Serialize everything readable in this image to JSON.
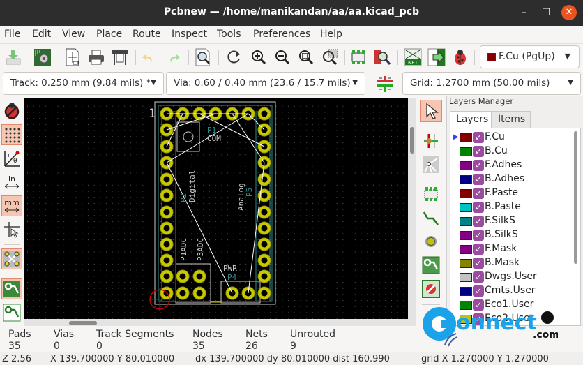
{
  "window": {
    "title": "Pcbnew — /home/manikandan/aa/aa.kicad_pcb",
    "minimize_label": "–",
    "maximize_label": "☐",
    "close_label": "✕"
  },
  "menu": [
    "File",
    "Edit",
    "View",
    "Place",
    "Route",
    "Inspect",
    "Tools",
    "Preferences",
    "Help"
  ],
  "toolbar": {
    "icons": [
      "save-icon",
      "board-setup-icon",
      "page-settings-icon",
      "print-icon",
      "plot-icon",
      "undo-icon",
      "redo-icon",
      "find-icon",
      "redraw-icon",
      "zoom-in-icon",
      "zoom-out-icon",
      "zoom-fit-icon",
      "zoom-selection-icon",
      "footprint-editor-icon",
      "footprint-viewer-icon",
      "netlist-icon",
      "update-from-schematic-icon",
      "drc-icon"
    ],
    "active_layer": {
      "label": "F.Cu (PgUp)",
      "color": "#840000"
    }
  },
  "toolbar2": {
    "track": "Track: 0.250 mm (9.84 mils) *",
    "via": "Via: 0.60 / 0.40 mm (23.6 / 15.7 mils) *",
    "grid": "Grid: 1.2700 mm (50.00 mils)"
  },
  "left_toolbar": {
    "items": [
      {
        "name": "drc-off-icon",
        "active": false
      },
      {
        "name": "grid-toggle-icon",
        "active": true
      },
      {
        "name": "polar-coords-icon",
        "active": false
      },
      {
        "name": "units-inches-icon",
        "label": "in",
        "active": false
      },
      {
        "name": "units-mm-icon",
        "label": "mm",
        "active": true
      },
      {
        "name": "cursor-shape-icon",
        "active": false
      },
      {
        "name": "ratsnest-icon",
        "active": true
      },
      {
        "name": "zone-fill-icon",
        "active": true
      },
      {
        "name": "zone-outline-icon",
        "active": false
      }
    ]
  },
  "right_toolbar": {
    "items": [
      "select-icon",
      "local-ratsnest-icon",
      "highlight-net-icon",
      "add-footprint-icon",
      "route-track-icon",
      "add-via-icon",
      "add-zone-icon",
      "add-keepout-icon"
    ]
  },
  "canvas": {
    "pin1_label": "1",
    "labels": {
      "p1": "P1",
      "com": "COM",
      "p2": "P2",
      "digital": "Digital",
      "analog": "Analog",
      "p5": "P5",
      "p1adc": "P1ADC",
      "p3adc": "P3ADC",
      "pwr": "PWR",
      "p4": "P4"
    }
  },
  "layers_manager": {
    "title": "Layers Manager",
    "tabs": [
      "Layers",
      "Items"
    ],
    "active_tab": "Layers",
    "layers": [
      {
        "name": "F.Cu",
        "color": "#840000",
        "visible": true,
        "selected": true
      },
      {
        "name": "B.Cu",
        "color": "#008400",
        "visible": true
      },
      {
        "name": "F.Adhes",
        "color": "#840084",
        "visible": true
      },
      {
        "name": "B.Adhes",
        "color": "#000084",
        "visible": true
      },
      {
        "name": "F.Paste",
        "color": "#840000",
        "visible": true
      },
      {
        "name": "B.Paste",
        "color": "#00c2c2",
        "visible": true
      },
      {
        "name": "F.SilkS",
        "color": "#008484",
        "visible": true
      },
      {
        "name": "B.SilkS",
        "color": "#840084",
        "visible": true
      },
      {
        "name": "F.Mask",
        "color": "#840084",
        "visible": true
      },
      {
        "name": "B.Mask",
        "color": "#848400",
        "visible": true
      },
      {
        "name": "Dwgs.User",
        "color": "#c2c2c2",
        "visible": true
      },
      {
        "name": "Cmts.User",
        "color": "#000084",
        "visible": true
      },
      {
        "name": "Eco1.User",
        "color": "#008400",
        "visible": true
      },
      {
        "name": "Eco2.User",
        "color": "#c2c200",
        "visible": true
      }
    ]
  },
  "message_panel": [
    {
      "label": "Pads",
      "value": "35"
    },
    {
      "label": "Vias",
      "value": "0"
    },
    {
      "label": "Track Segments",
      "value": "0"
    },
    {
      "label": "Nodes",
      "value": "35"
    },
    {
      "label": "Nets",
      "value": "26"
    },
    {
      "label": "Unrouted",
      "value": "9"
    }
  ],
  "status_bar": {
    "zoom": "Z 2.56",
    "xy": "X 139.700000  Y 80.010000",
    "delta": "dx 139.700000  dy 80.010000  dist 160.990",
    "grid": "grid X 1.270000  Y 1.270000"
  },
  "watermark": {
    "text": "onnect",
    "suffix": ".com",
    "letter": "C"
  }
}
